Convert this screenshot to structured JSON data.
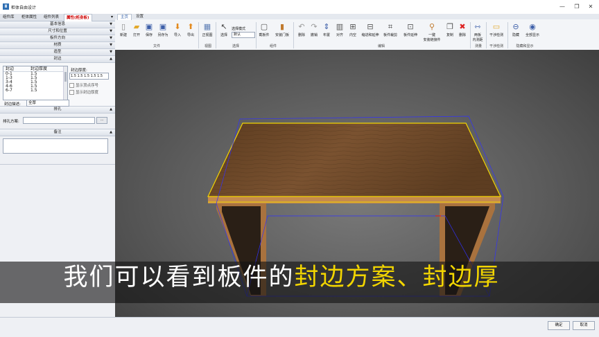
{
  "window": {
    "title": "柜体自由设计",
    "app_icon": "Ⅱ",
    "minimize": "—",
    "restore": "❐",
    "close": "✕"
  },
  "left_tabs": [
    "组件库",
    "柜体属性",
    "组件列表",
    "属性(柜身板)"
  ],
  "sections": {
    "basic": "基本信息",
    "size": "尺寸和位置",
    "texture_dir": "板件方向",
    "material": "材质",
    "shape": "造型",
    "edge": "封边",
    "holes": "排孔",
    "notes": "备注"
  },
  "edge_table": {
    "headers": [
      "封边",
      "封边厚度"
    ],
    "rows": [
      [
        "0-1",
        "1.5"
      ],
      [
        "1-3",
        "1.5"
      ],
      [
        "3-4",
        "1.5"
      ],
      [
        "4-6",
        "1.5"
      ],
      [
        "6-7",
        "1.5"
      ]
    ]
  },
  "edge_thickness_label": "封边厚度:",
  "edge_thickness_value": "1.5 1.5 1.5 1.5 1.5",
  "show_vertex_label": "显示顶点序号",
  "show_edge_thickness_label": "显示封边厚度",
  "edge_desc_label": "封边描述:",
  "edge_desc_value": "全厚",
  "hole_scheme_label": "排孔方案:",
  "hole_browse": "...",
  "ribbon_tabs": [
    "主页",
    "设置"
  ],
  "tools": {
    "new": "新建",
    "open": "打开",
    "save": "保存",
    "saveas": "另存为",
    "import": "导入",
    "export": "导出",
    "front_view": "正视图",
    "select": "选择",
    "select_mode_label": "选择模式",
    "select_mode_value": "默认",
    "sample": "截板件",
    "install_door": "安装门板",
    "delete": "删除",
    "undo": "撤销",
    "layout": "布置",
    "align": "对齐",
    "inner": "内空",
    "shrink_extend": "缩进和延伸",
    "board_crop": "板件裁剪",
    "board_extend": "板件延伸",
    "one_key": "一键",
    "one_key_2": "安装链接件",
    "copy": "复制",
    "remove": "删除",
    "measure": "两板",
    "measure_2": "内测距",
    "interference": "干涉检测",
    "hide": "隐藏",
    "show_all": "全部显示"
  },
  "groups": {
    "file": "文件",
    "view": "视图",
    "select": "选择",
    "assembly": "组件",
    "edit": "编辑",
    "measure": "测量",
    "interference": "干涉检测",
    "hide_show": "隐藏和显示"
  },
  "subtitle": {
    "plain": "我们可以看到板件的",
    "highlight": "封边方案、封边厚"
  },
  "footer": {
    "ok": "确定",
    "cancel": "取消"
  },
  "colors": {
    "wood": "#6b4a2a",
    "highlight": "#f2d500",
    "wire": "#3030ff"
  }
}
